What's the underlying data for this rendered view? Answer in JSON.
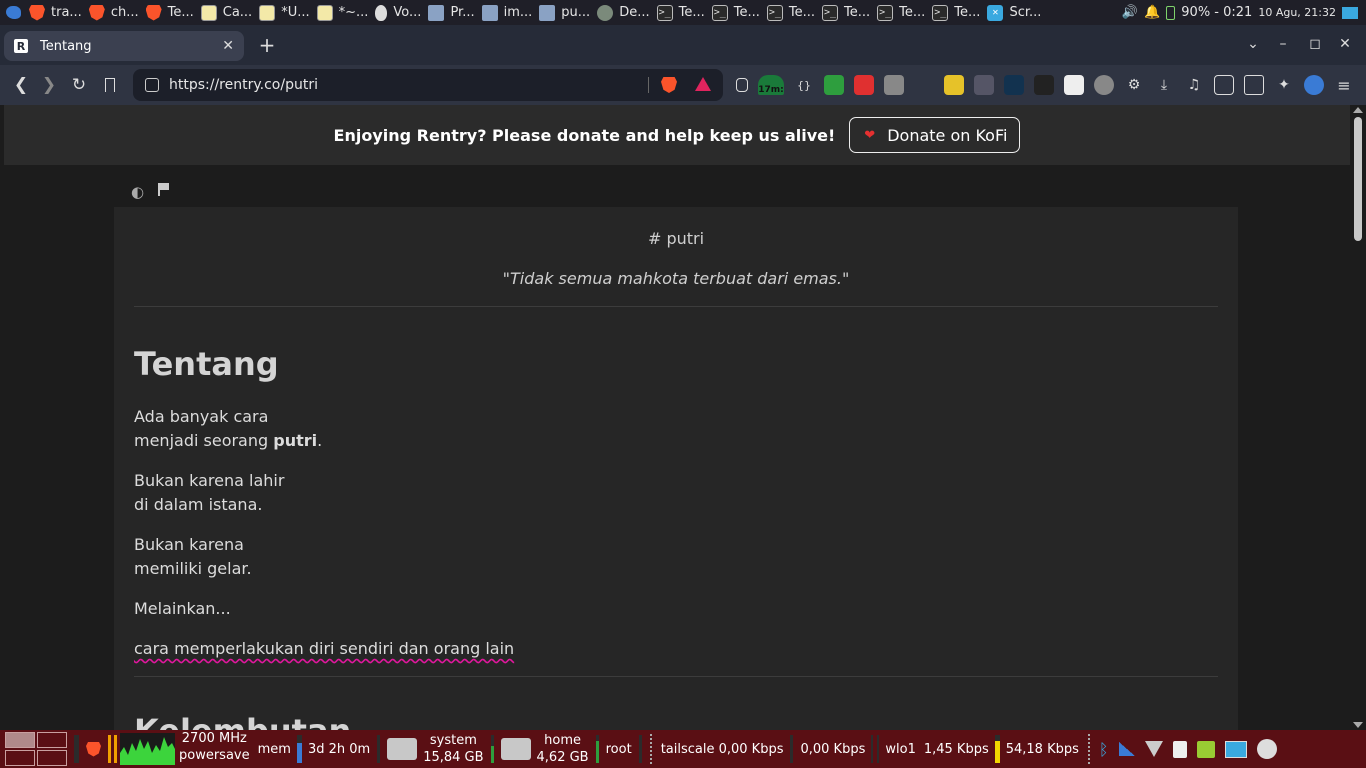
{
  "top_panel": {
    "tasks": [
      {
        "label": "tra...",
        "icon": "brave-icon"
      },
      {
        "label": "ch...",
        "icon": "brave-icon"
      },
      {
        "label": "Te...",
        "icon": "brave-icon"
      },
      {
        "label": "Ca...",
        "icon": "note-icon"
      },
      {
        "label": "*U...",
        "icon": "note-icon"
      },
      {
        "label": "*~...",
        "icon": "note-icon"
      },
      {
        "label": "Vo...",
        "icon": "mouse-icon"
      },
      {
        "label": "Pr...",
        "icon": "folder-icon"
      },
      {
        "label": "im...",
        "icon": "folder-icon"
      },
      {
        "label": "pu...",
        "icon": "folder-icon"
      },
      {
        "label": "De...",
        "icon": "image-viewer-icon"
      },
      {
        "label": "Te...",
        "icon": "terminal-icon"
      },
      {
        "label": "Te...",
        "icon": "terminal-icon"
      },
      {
        "label": "Te...",
        "icon": "terminal-icon"
      },
      {
        "label": "Te...",
        "icon": "terminal-icon"
      },
      {
        "label": "Te...",
        "icon": "terminal-icon"
      },
      {
        "label": "Te...",
        "icon": "terminal-icon"
      },
      {
        "label": "Scr...",
        "icon": "screenshot-icon"
      }
    ],
    "battery": "90% - 0:21",
    "clock": "10 Agu, 21:32"
  },
  "browser": {
    "tab_title": "Tentang",
    "tab_favicon": "R",
    "url": "https://rentry.co/putri",
    "ext_timer": "17m:"
  },
  "page": {
    "donate_message": "Enjoying Rentry? Please donate and help keep us alive!",
    "donate_button": "Donate on KoFi",
    "heading_putri": "# putri",
    "quote": "\"Tidak semua mahkota terbuat dari emas.\"",
    "section_title": "Tentang",
    "p1_line1": "Ada banyak cara",
    "p1_line2_prefix": "menjadi seorang ",
    "p1_bold": "putri",
    "p1_suffix": ".",
    "p2_line1": "Bukan karena lahir",
    "p2_line2": "di dalam istana.",
    "p3_line1": "Bukan karena",
    "p3_line2": "memiliki gelar.",
    "p4": "Melainkan...",
    "p5": "cara memperlakukan diri sendiri dan orang lain",
    "next_section_title": "Kelembutan"
  },
  "bottom_panel": {
    "cpu_freq": "2700 MHz",
    "cpu_gov": "powersave",
    "mem_label": "mem",
    "uptime": "3d 2h 0m",
    "disk_system_label": "system",
    "disk_system_size": "15,84 GB",
    "disk_home_label": "home",
    "disk_home_size": "4,62 GB",
    "root_label": "root",
    "tailscale": "tailscale 0,00 Kbps",
    "net2": "0,00 Kbps",
    "wlo1": "wlo1",
    "wlo1_up": "1,45 Kbps",
    "wlo1_down": "54,18 Kbps"
  }
}
